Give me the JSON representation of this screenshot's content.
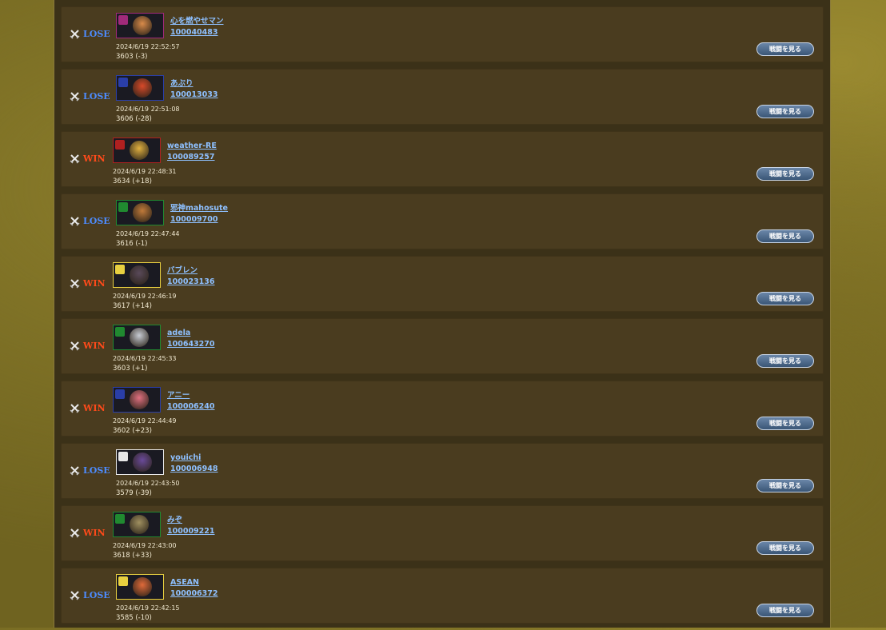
{
  "colors": {
    "lose": "#4d8cff",
    "win": "#ff4a1a",
    "link": "#8ec0ff",
    "button": "#4a6688"
  },
  "matches": [
    {
      "result": "LOSE",
      "name": "心を燃やせマン",
      "id": "100040483",
      "datetime": "2024/6/19 22:52:57",
      "rating": "3603 (-3)",
      "frame_color": "#a02a7a",
      "face_color": "#d98b4a",
      "button": "戦闘を見る"
    },
    {
      "result": "LOSE",
      "name": "あぶり",
      "id": "100013033",
      "datetime": "2024/6/19 22:51:08",
      "rating": "3606 (-28)",
      "frame_color": "#2a3ea8",
      "face_color": "#d84a2a",
      "button": "戦闘を見る"
    },
    {
      "result": "WIN",
      "name": "weather-RE",
      "id": "100089257",
      "datetime": "2024/6/19 22:48:31",
      "rating": "3634 (+18)",
      "frame_color": "#b02020",
      "face_color": "#e0b040",
      "button": "戦闘を見る"
    },
    {
      "result": "LOSE",
      "name": "邪神mahosute",
      "id": "100009700",
      "datetime": "2024/6/19 22:47:44",
      "rating": "3616 (-1)",
      "frame_color": "#208a30",
      "face_color": "#c07a3a",
      "button": "戦闘を見る"
    },
    {
      "result": "WIN",
      "name": "バブレン",
      "id": "100023136",
      "datetime": "2024/6/19 22:46:19",
      "rating": "3617 (+14)",
      "frame_color": "#e8d040",
      "face_color": "#5a4a5a",
      "button": "戦闘を見る"
    },
    {
      "result": "WIN",
      "name": "adela",
      "id": "100643270",
      "datetime": "2024/6/19 22:45:33",
      "rating": "3603 (+1)",
      "frame_color": "#208a30",
      "face_color": "#c8ccd4",
      "button": "戦闘を見る"
    },
    {
      "result": "WIN",
      "name": "アニー",
      "id": "100006240",
      "datetime": "2024/6/19 22:44:49",
      "rating": "3602 (+23)",
      "frame_color": "#2a3ea8",
      "face_color": "#e07080",
      "button": "戦闘を見る"
    },
    {
      "result": "LOSE",
      "name": "youichi",
      "id": "100006948",
      "datetime": "2024/6/19 22:43:50",
      "rating": "3579 (-39)",
      "frame_color": "#e8e8e8",
      "face_color": "#6a4a9a",
      "button": "戦闘を見る"
    },
    {
      "result": "WIN",
      "name": "みぞ",
      "id": "100009221",
      "datetime": "2024/6/19 22:43:00",
      "rating": "3618 (+33)",
      "frame_color": "#208a30",
      "face_color": "#a09060",
      "button": "戦闘を見る"
    },
    {
      "result": "LOSE",
      "name": "ASEAN",
      "id": "100006372",
      "datetime": "2024/6/19 22:42:15",
      "rating": "3585 (-10)",
      "frame_color": "#e8d040",
      "face_color": "#e06a3a",
      "button": "戦闘を見る"
    }
  ]
}
